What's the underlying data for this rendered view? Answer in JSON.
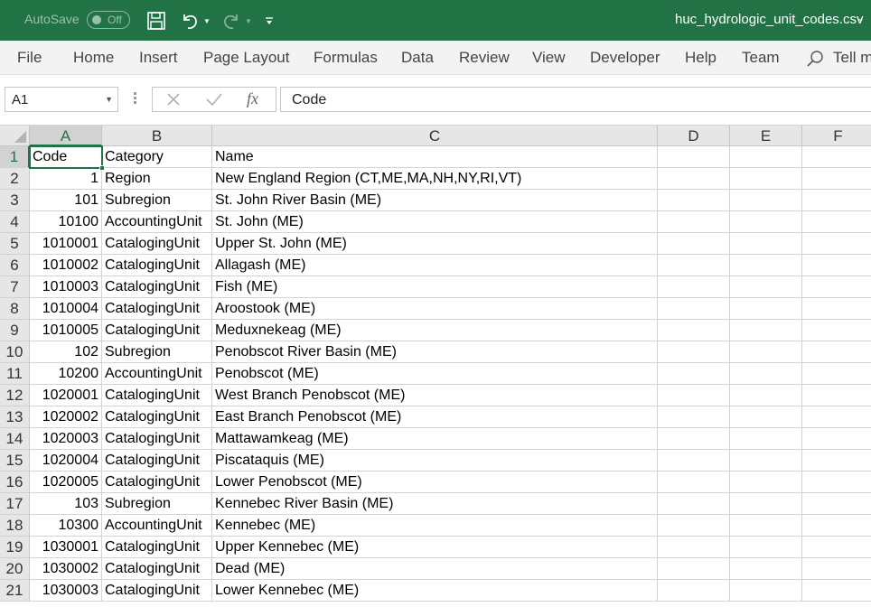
{
  "title_bar": {
    "autosave_label": "AutoSave",
    "autosave_state": "Off",
    "file_name": "huc_hydrologic_unit_codes.csv",
    "minimize": "-",
    "accent_color": "#217346"
  },
  "ribbon": {
    "tabs": [
      "File",
      "Home",
      "Insert",
      "Page Layout",
      "Formulas",
      "Data",
      "Review",
      "View",
      "Developer",
      "Help",
      "Team"
    ],
    "tell_me": "Tell me"
  },
  "formula_bar": {
    "name_box": "A1",
    "fx": "fx",
    "content": "Code"
  },
  "grid": {
    "columns": [
      "A",
      "B",
      "C",
      "D",
      "E",
      "F"
    ],
    "selected_cell": "A1",
    "rows": [
      {
        "n": "1",
        "a": "Code",
        "b": "Category",
        "c": "Name"
      },
      {
        "n": "2",
        "a": "1",
        "b": "Region",
        "c": "New England Region (CT,ME,MA,NH,NY,RI,VT)"
      },
      {
        "n": "3",
        "a": "101",
        "b": "Subregion",
        "c": "St. John River Basin (ME)"
      },
      {
        "n": "4",
        "a": "10100",
        "b": "AccountingUnit",
        "c": "St. John (ME)"
      },
      {
        "n": "5",
        "a": "1010001",
        "b": "CatalogingUnit",
        "c": "Upper St. John (ME)"
      },
      {
        "n": "6",
        "a": "1010002",
        "b": "CatalogingUnit",
        "c": "Allagash (ME)"
      },
      {
        "n": "7",
        "a": "1010003",
        "b": "CatalogingUnit",
        "c": "Fish (ME)"
      },
      {
        "n": "8",
        "a": "1010004",
        "b": "CatalogingUnit",
        "c": "Aroostook (ME)"
      },
      {
        "n": "9",
        "a": "1010005",
        "b": "CatalogingUnit",
        "c": "Meduxnekeag (ME)"
      },
      {
        "n": "10",
        "a": "102",
        "b": "Subregion",
        "c": "Penobscot River Basin (ME)"
      },
      {
        "n": "11",
        "a": "10200",
        "b": "AccountingUnit",
        "c": "Penobscot (ME)"
      },
      {
        "n": "12",
        "a": "1020001",
        "b": "CatalogingUnit",
        "c": "West Branch Penobscot (ME)"
      },
      {
        "n": "13",
        "a": "1020002",
        "b": "CatalogingUnit",
        "c": "East Branch Penobscot (ME)"
      },
      {
        "n": "14",
        "a": "1020003",
        "b": "CatalogingUnit",
        "c": "Mattawamkeag (ME)"
      },
      {
        "n": "15",
        "a": "1020004",
        "b": "CatalogingUnit",
        "c": "Piscataquis (ME)"
      },
      {
        "n": "16",
        "a": "1020005",
        "b": "CatalogingUnit",
        "c": "Lower Penobscot (ME)"
      },
      {
        "n": "17",
        "a": "103",
        "b": "Subregion",
        "c": "Kennebec River Basin (ME)"
      },
      {
        "n": "18",
        "a": "10300",
        "b": "AccountingUnit",
        "c": "Kennebec (ME)"
      },
      {
        "n": "19",
        "a": "1030001",
        "b": "CatalogingUnit",
        "c": "Upper Kennebec (ME)"
      },
      {
        "n": "20",
        "a": "1030002",
        "b": "CatalogingUnit",
        "c": "Dead (ME)"
      },
      {
        "n": "21",
        "a": "1030003",
        "b": "CatalogingUnit",
        "c": "Lower Kennebec (ME)"
      }
    ]
  }
}
